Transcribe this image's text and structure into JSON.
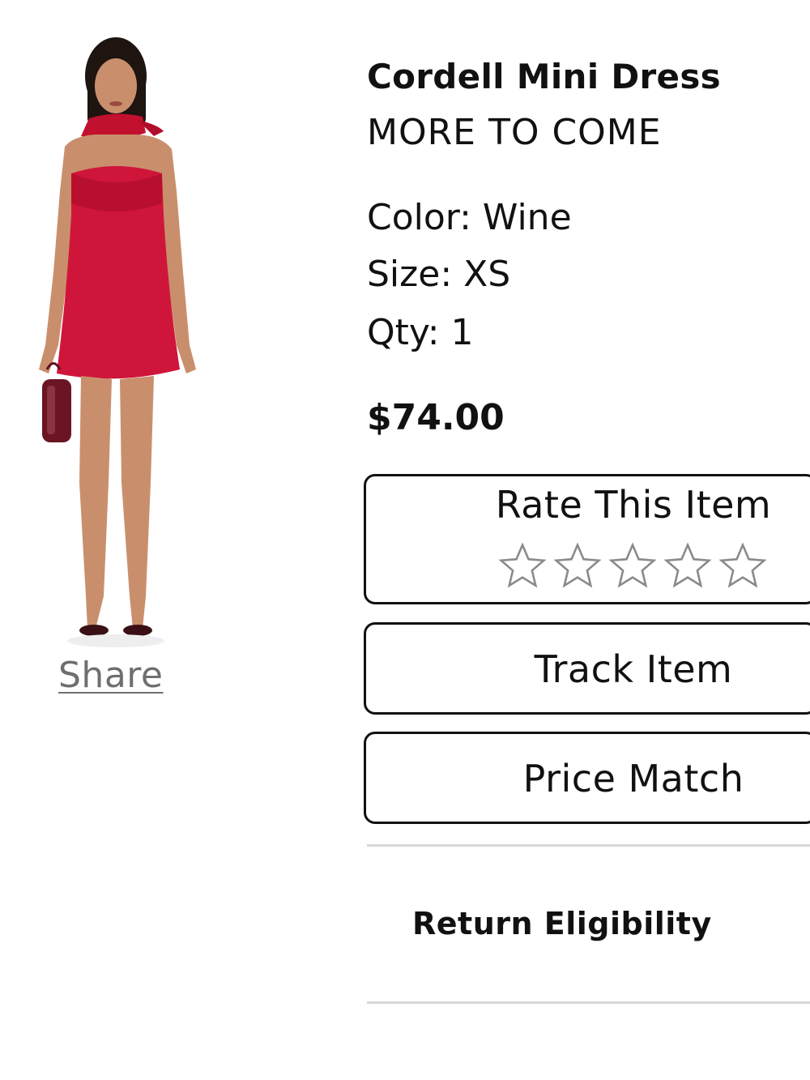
{
  "product": {
    "title": "Cordell Mini Dress",
    "brand": "MORE TO COME",
    "color": "Color: Wine",
    "size": "Size: XS",
    "qty": "Qty: 1",
    "price": "$74.00"
  },
  "share_label": "Share",
  "rating": {
    "label": "Rate This Item",
    "max_stars": 5,
    "current": 0
  },
  "actions": {
    "track_label": "Track Item",
    "price_match_label": "Price Match"
  },
  "return_eligibility_label": "Return Eligibility",
  "colors": {
    "dress": "#d0153a",
    "text": "#111111",
    "share": "#6f6f6f",
    "divider": "#d8d8d8"
  }
}
